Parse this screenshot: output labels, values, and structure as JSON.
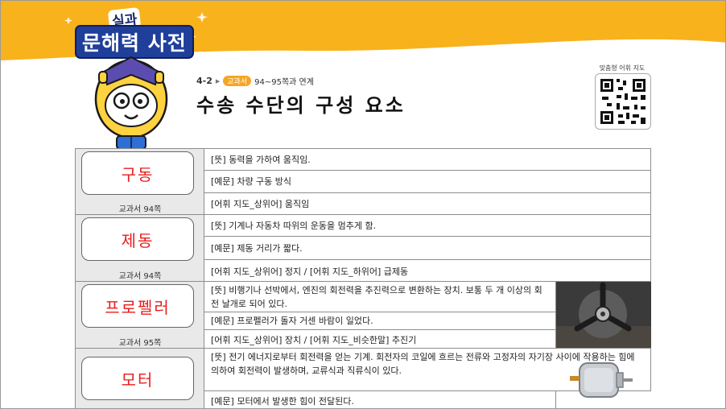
{
  "header": {
    "logo_small": "실과",
    "logo_big": "문해력 사전",
    "colors": {
      "band": "#f8b21c",
      "accent": "#1f3f9b",
      "word": "#e61e1e"
    }
  },
  "lesson": {
    "unit": "4-2",
    "textbook_badge": "교과서",
    "pages": "94~95쪽과 연계",
    "title": "수송 수단의 구성 요소"
  },
  "qr": {
    "label": "맞춤형 어휘 지도",
    "icon": "qr-code-icon"
  },
  "entries": [
    {
      "word": "구동",
      "ref": "교과서 94쪽",
      "rows": [
        "[뜻] 동력을 가하여 움직임.",
        "[예문] 차량 구동 방식",
        "[어휘 지도_상위어] 움직임"
      ]
    },
    {
      "word": "제동",
      "ref": "교과서 94쪽",
      "rows": [
        "[뜻] 기계나 자동차 따위의 운동을 멈추게 함.",
        "[예문] 제동 거리가 짧다.",
        "[어휘 지도_상위어] 정지 / [어휘 지도_하위어] 급제동"
      ]
    },
    {
      "word": "프로펠러",
      "ref": "교과서 95쪽",
      "rows": [
        "[뜻] 비행기나 선박에서, 엔진의 회전력을 추진력으로 변환하는 장치. 보통 두 개 이상의 회전 날개로 되어 있다.",
        "[예문] 프로펠러가 돌자 거센 바람이 일었다.",
        "[어휘 지도_상위어] 장치 / [어휘 지도_비슷한말] 추진기"
      ],
      "photo": "propeller-photo"
    },
    {
      "word": "모터",
      "ref": "",
      "rows": [
        "[뜻] 전기 에너지로부터 회전력을 얻는 기계. 회전자의 코일에 흐르는 전류와 고정자의 자기장 사이에 작용하는 힘에 의하여 회전력이 발생하며, 교류식과 직류식이 있다.",
        "[예문] 모터에서 발생한 힘이 전달된다."
      ],
      "photo": "motor-photo"
    }
  ]
}
